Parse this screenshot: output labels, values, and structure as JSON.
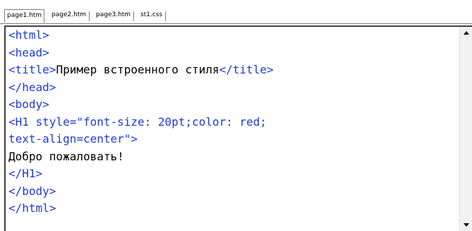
{
  "tabs": [
    {
      "label": "page1.htm",
      "active": true
    },
    {
      "label": "page2.htm",
      "active": false
    },
    {
      "label": "page3.htm",
      "active": false
    },
    {
      "label": "st1.css",
      "active": false
    }
  ],
  "editor": {
    "lines": [
      [
        {
          "t": "tag",
          "v": "<html>"
        }
      ],
      [
        {
          "t": "tag",
          "v": "<head>"
        }
      ],
      [
        {
          "t": "tag",
          "v": "<title>"
        },
        {
          "t": "txt",
          "v": "Пример встроенного стиля"
        },
        {
          "t": "tag",
          "v": "</title>"
        }
      ],
      [
        {
          "t": "tag",
          "v": "</head>"
        }
      ],
      [
        {
          "t": "tag",
          "v": "<body>"
        }
      ],
      [
        {
          "t": "tag",
          "v": "<H1 style=\"font-size: 20pt;color: red;"
        }
      ],
      [
        {
          "t": "tag",
          "v": "text-align=center\">"
        }
      ],
      [
        {
          "t": "txt",
          "v": "Добро пожаловать!"
        }
      ],
      [
        {
          "t": "tag",
          "v": "</H1>"
        }
      ],
      [
        {
          "t": "tag",
          "v": "</body>"
        }
      ],
      [
        {
          "t": "tag",
          "v": "</html>"
        }
      ]
    ]
  },
  "colors": {
    "tag": "#1f3bd6",
    "text": "#000000"
  }
}
